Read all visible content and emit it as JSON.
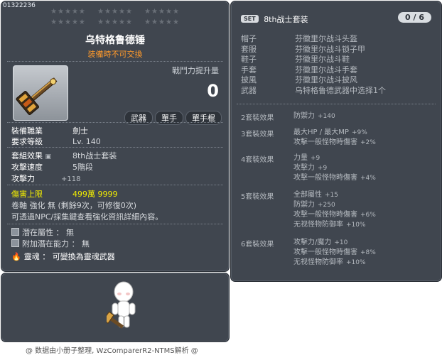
{
  "item": {
    "id": "01322236",
    "stars_row1": [
      "★★★★★",
      "★★★★★",
      "★★★★★"
    ],
    "stars_row2": [
      "★★★★★",
      "★★★★★",
      "★★★★★"
    ],
    "name": "乌特格鲁德锤",
    "note": "装備時不可交換",
    "power_label": "戰鬥力提升量",
    "power_value": "0",
    "tags": [
      "武器",
      "單手",
      "單手棍"
    ],
    "job_label": "裝備職業",
    "job_value": "劍士",
    "req_level_label": "要求等級",
    "req_level_value": "Lv. 140",
    "set_effect_label": "套組效果",
    "set_effect_value": "8th战士套装",
    "attack_speed_label": "攻擊速度",
    "attack_speed_value": "5階段",
    "attack_label": "攻擊力",
    "attack_value": "+118",
    "damage_cap_label": "傷害上限",
    "damage_cap_value": "499萬 9999",
    "scroll_line": "卷軸 強化 無 (剩餘9次，可修復0次)",
    "npc_line": "可透過NPC/採集鍵查看強化資訊詳細內容。",
    "potential_label": "潛在屬性",
    "potential_value": "： 無",
    "additional_potential_label": "附加潛在能力",
    "additional_potential_value": "： 無",
    "soul_label": "靈魂",
    "soul_value": "： 可變換為靈魂武器"
  },
  "set": {
    "badge": "SET",
    "name": "8th战士套装",
    "count": "0 / 6",
    "pieces": [
      {
        "slot": "帽子",
        "item": "芬徽里尔战斗头盔"
      },
      {
        "slot": "套服",
        "item": "芬徽里尔战斗锁子甲"
      },
      {
        "slot": "鞋子",
        "item": "芬徽里尔战斗鞋"
      },
      {
        "slot": "手套",
        "item": "芬徽里尔战斗手套"
      },
      {
        "slot": "披風",
        "item": "芬徽里尔战斗披风"
      },
      {
        "slot": "武器",
        "item": "乌特格鲁德武器中选择1个"
      }
    ],
    "effects": [
      {
        "label": "2套裝效果",
        "lines": [
          [
            "防禦力",
            "+140"
          ]
        ]
      },
      {
        "label": "3套裝效果",
        "lines": [
          [
            "最大HP / 最大MP",
            "+9%"
          ],
          [
            "攻擊一般怪物時傷害",
            "+2%"
          ]
        ]
      },
      {
        "label": "4套裝效果",
        "lines": [
          [
            "力量",
            "+9"
          ],
          [
            "攻擊力",
            "+9"
          ],
          [
            "攻擊一般怪物時傷害",
            "+4%"
          ]
        ]
      },
      {
        "label": "5套裝效果",
        "lines": [
          [
            "全部屬性",
            "+15"
          ],
          [
            "防禦力",
            "+250"
          ],
          [
            "攻擊一般怪物時傷害",
            "+6%"
          ],
          [
            "无视怪物防御率",
            "+10%"
          ]
        ]
      },
      {
        "label": "6套裝效果",
        "lines": [
          [
            "攻擊力/魔力",
            "+10"
          ],
          [
            "攻擊一般怪物時傷害",
            "+8%"
          ],
          [
            "无视怪物防御率",
            "+10%"
          ]
        ]
      }
    ]
  },
  "credit": "@ 数据由小册子整理, WzComparerR2-NTMS解析 @"
}
